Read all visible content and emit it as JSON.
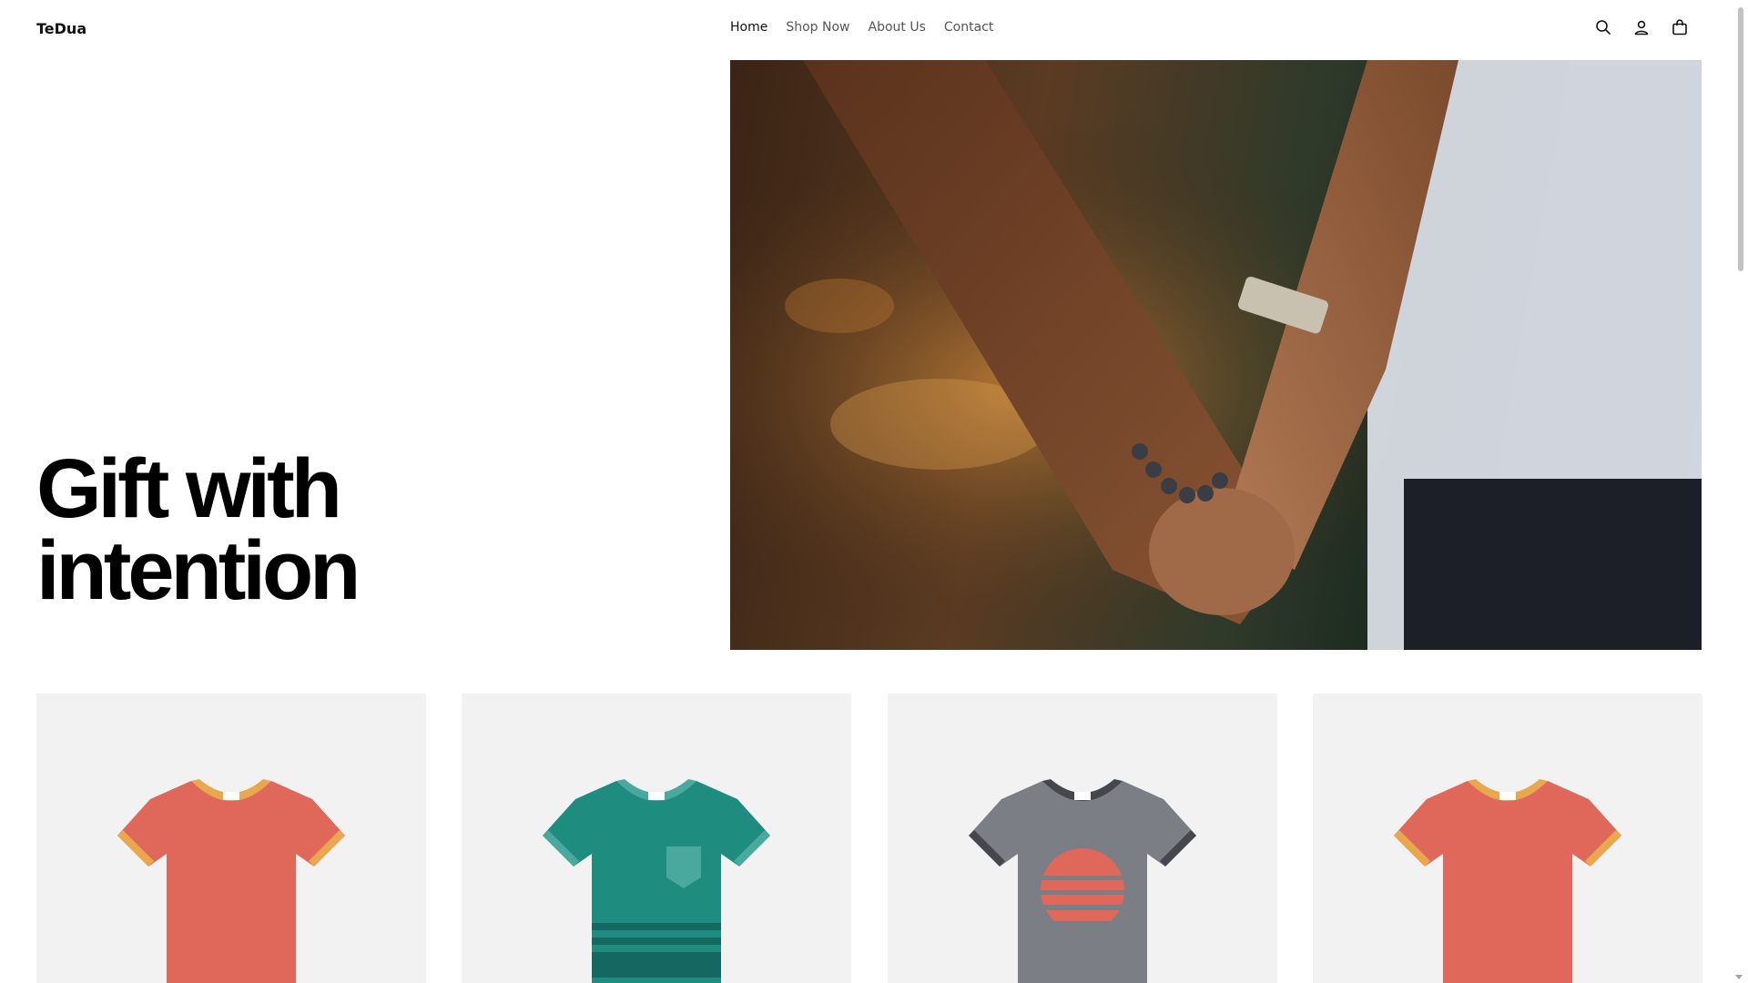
{
  "brand": {
    "logo": "TeDua"
  },
  "nav": {
    "items": [
      {
        "label": "Home",
        "active": true
      },
      {
        "label": "Shop Now",
        "active": false
      },
      {
        "label": "About Us",
        "active": false
      },
      {
        "label": "Contact",
        "active": false
      }
    ]
  },
  "header_icons": [
    "search-icon",
    "account-icon",
    "cart-icon"
  ],
  "hero": {
    "title": "Gift with\nintention",
    "image": "couple-holding-hands-photo"
  },
  "products": [
    {
      "icon": "tshirt-orange-icon",
      "color": "#e0685a",
      "trim": "#e9a84e"
    },
    {
      "icon": "tshirt-teal-pocket-striped-icon",
      "color": "#1f8c80",
      "trim": "#4aa99e"
    },
    {
      "icon": "tshirt-gray-sunset-icon",
      "color": "#7b7e85",
      "trim": "#45474c"
    },
    {
      "icon": "tshirt-orange-icon",
      "color": "#e0685a",
      "trim": "#e9a84e"
    }
  ],
  "colors": {
    "text": "#121212",
    "nav_muted": "#555555",
    "card_bg": "#f2f2f2"
  }
}
